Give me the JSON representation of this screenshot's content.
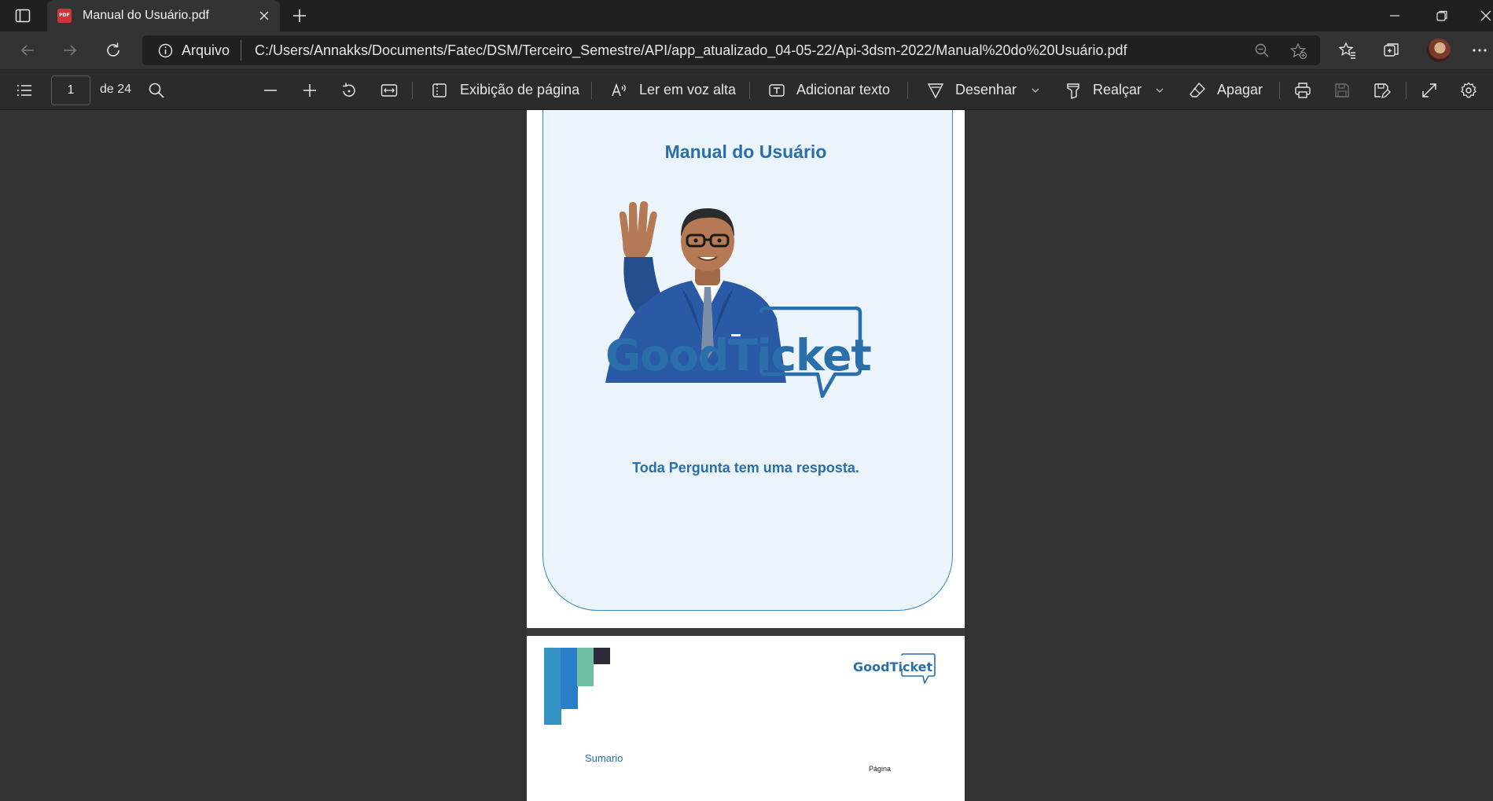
{
  "browser": {
    "tab": {
      "title": "Manual do Usuário.pdf",
      "favicon_text": "PDF"
    },
    "address": {
      "scheme_label": "Arquivo",
      "url": "C:/Users/Annakks/Documents/Fatec/DSM/Terceiro_Semestre/API/app_atualizado_04-05-22/Api-3dsm-2022/Manual%20do%20Usuário.pdf"
    }
  },
  "pdf_toolbar": {
    "current_page": "1",
    "page_count_label": "de 24",
    "page_view_label": "Exibição de página",
    "read_aloud_label": "Ler em voz alta",
    "add_text_label": "Adicionar texto",
    "draw_label": "Desenhar",
    "highlight_label": "Realçar",
    "erase_label": "Apagar"
  },
  "document": {
    "page1": {
      "title": "Manual do Usuário",
      "logo_text": "GoodTicket",
      "tagline": "Toda Pergunta tem uma resposta."
    },
    "page2": {
      "logo_text": "GoodTicket",
      "toc_title": "Sumario",
      "page_column_label": "Página"
    }
  },
  "colors": {
    "brand_blue": "#2a6eaa",
    "card_background": "#eaf4fa",
    "viewer_background": "#333333"
  }
}
